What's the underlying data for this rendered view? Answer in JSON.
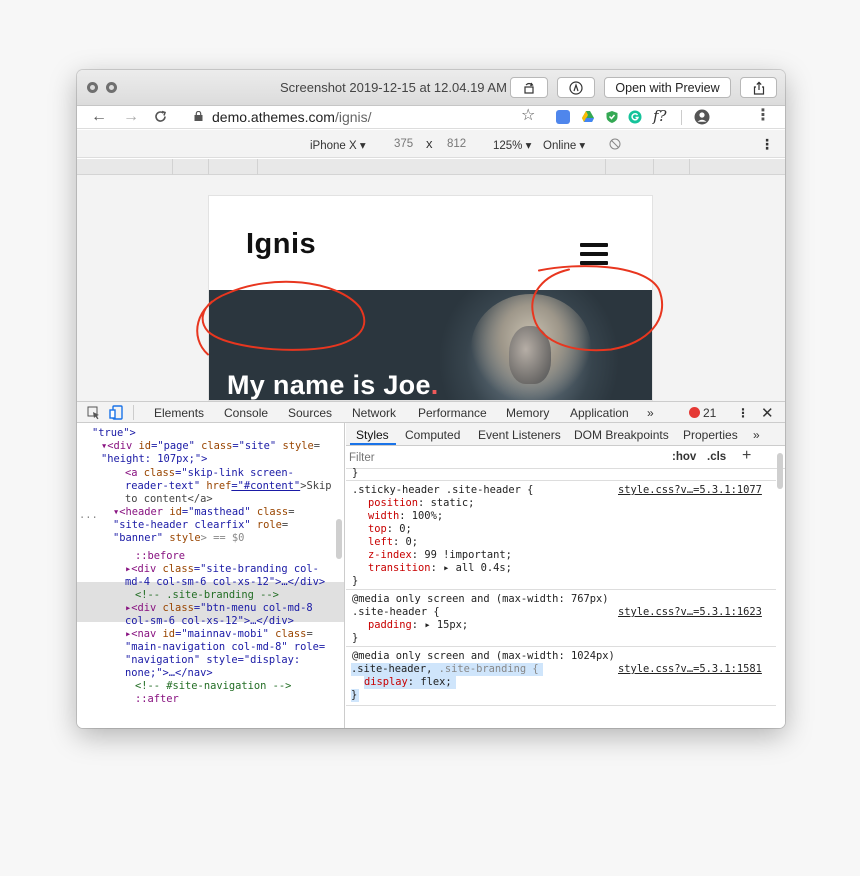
{
  "preview": {
    "title": "Screenshot 2019-12-15 at 12.04.19 AM",
    "open_with": "Open with Preview",
    "rotate_icon": "rotate-icon",
    "markup_icon": "markup-icon",
    "share_icon": "share-icon"
  },
  "browser": {
    "url_host": "demo.athemes.com",
    "url_path": "/ignis/",
    "ext_f_label": "f?"
  },
  "device_toolbar": {
    "device": "iPhone X ▾",
    "width": "375",
    "times": "x",
    "height": "812",
    "zoom": "125% ▾",
    "network": "Online ▾"
  },
  "site": {
    "logo": "Ignis",
    "hero_title": "My name is Joe",
    "hero_dot": "."
  },
  "devtools": {
    "tabs": [
      "Elements",
      "Console",
      "Sources",
      "Network",
      "Performance",
      "Memory",
      "Application",
      "»"
    ],
    "error_count": "21",
    "sub_tabs": [
      "Styles",
      "Computed",
      "Event Listeners",
      "DOM Breakpoints",
      "Properties",
      "»"
    ],
    "filter_placeholder": "Filter",
    "hov": ":hov",
    "cls": ".cls",
    "plus": "+",
    "ellipsis": "..."
  },
  "css_rules": {
    "r0_close": "}",
    "r1_selector": ".sticky-header .site-header {",
    "r1_source": "style.css?v…=5.3.1:1077",
    "r1_props": [
      {
        "p": "position",
        "v": "static;"
      },
      {
        "p": "width",
        "v": "100%;"
      },
      {
        "p": "top",
        "v": "0;"
      },
      {
        "p": "left",
        "v": "0;"
      },
      {
        "p": "z-index",
        "v": "99 !important;"
      },
      {
        "p": "transition",
        "v": "▸ all 0.4s;"
      }
    ],
    "r1_close": "}",
    "r2_media": "@media only screen and (max-width: 767px)",
    "r2_selector": ".site-header {",
    "r2_source": "style.css?v…=5.3.1:1623",
    "r2_prop": "padding",
    "r2_val": "▸ 15px;",
    "r2_close": "}",
    "r3_media": "@media only screen and (max-width: 1024px)",
    "r3_selector_a": ".site-header,",
    "r3_selector_b": ".site-branding {",
    "r3_source": "style.css?v…=5.3.1:1581",
    "r3_prop": "display",
    "r3_val": "flex;",
    "r3_close": "}"
  },
  "dom": {
    "l0": "\"true\">",
    "l1a": "▾<div ",
    "l1b": "id",
    "l1c": "=\"page\" ",
    "l1d": "class",
    "l1e": "=\"site\" ",
    "l1f": "style",
    "l2": "\"height: 107px;\">",
    "l3a": "<a ",
    "l3b": "class",
    "l3c": "=\"skip-link screen-",
    "l4a": "reader-text\" ",
    "l4b": "href",
    "l4c": "=\"#content\"",
    "l4d": ">Skip",
    "l5": "to content</a>",
    "l6a": "▾<header ",
    "l6b": "id",
    "l6c": "=\"masthead\" ",
    "l6d": "class",
    "l7a": "\"site-header clearfix\" ",
    "l7b": "role",
    "l8a": "\"banner\" ",
    "l8b": "style",
    "l8c": "> == $0",
    "l9": "::before",
    "l10a": "▸<div ",
    "l10b": "class",
    "l10c": "=\"site-branding col-",
    "l11": "md-4 col-sm-6 col-xs-12\">…</div>",
    "l12": "<!-- .site-branding -->",
    "l13a": "▸<div ",
    "l13b": "class",
    "l13c": "=\"btn-menu col-md-8",
    "l14": "col-sm-6 col-xs-12\">…</div>",
    "l15a": "▸<nav ",
    "l15b": "id",
    "l15c": "=\"mainnav-mobi\" ",
    "l15d": "class",
    "l16": "\"main-navigation col-md-8\" role=",
    "l17": "\"navigation\" style=\"display:",
    "l18": "none;\">…</nav>",
    "l19": "<!-- #site-navigation -->",
    "l20": "::after"
  },
  "colors": {
    "annotation": "#e8361f",
    "selected_rule": "#cfe5fb"
  }
}
